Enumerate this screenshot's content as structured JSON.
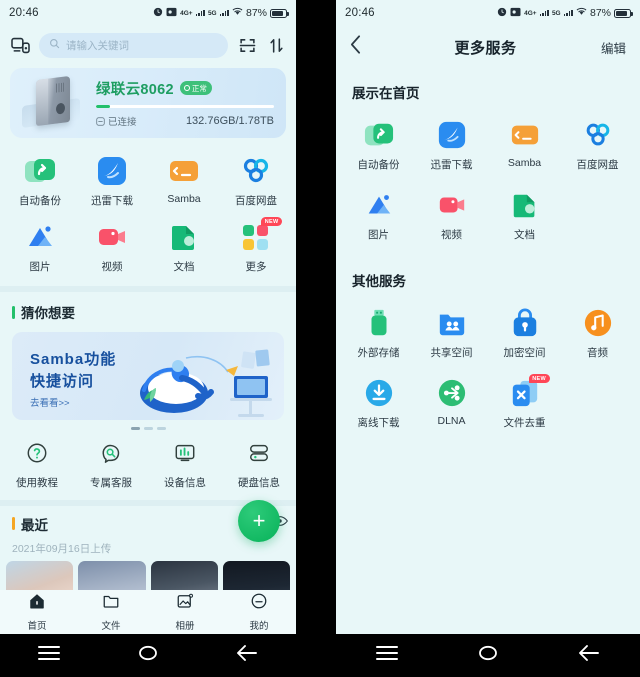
{
  "status_bar": {
    "time": "20:46",
    "battery_percent": "87%",
    "net_1": "4G+",
    "net_2": "5G",
    "icons": [
      "alarm-icon",
      "screen-record-icon",
      "signal-icon",
      "signal-icon",
      "wifi-icon",
      "battery-icon"
    ]
  },
  "left": {
    "toolbar": {
      "cast_icon": "cast-device-icon",
      "search_placeholder": "请输入关键词",
      "search_icon": "search-icon",
      "scan_icon": "scan-code-icon",
      "transfer_icon": "transfer-icon"
    },
    "device": {
      "name": "绿联云8062",
      "status_badge": "正常",
      "connection": "已连接",
      "capacity": "132.76GB/1.78TB",
      "usage_percent": 8,
      "image": "nas-device-image"
    },
    "apps": [
      {
        "label": "自动备份",
        "icon": "auto-backup-icon"
      },
      {
        "label": "迅雷下载",
        "icon": "xunlei-download-icon"
      },
      {
        "label": "Samba",
        "icon": "samba-icon"
      },
      {
        "label": "百度网盘",
        "icon": "baidu-netdisk-icon"
      },
      {
        "label": "图片",
        "icon": "photos-icon"
      },
      {
        "label": "视频",
        "icon": "video-icon"
      },
      {
        "label": "文档",
        "icon": "document-icon"
      },
      {
        "label": "更多",
        "icon": "more-apps-icon",
        "badge": "NEW"
      }
    ],
    "guess": {
      "title": "猜你想要",
      "accent": "#23c06b",
      "banner": {
        "line1": "Samba功能",
        "line2": "快捷访问",
        "cta": "去看看>>"
      },
      "dots": 4,
      "active_dot": 0
    },
    "tools": [
      {
        "label": "使用教程",
        "icon": "question-circle-icon"
      },
      {
        "label": "专属客服",
        "icon": "customer-service-icon"
      },
      {
        "label": "设备信息",
        "icon": "device-info-icon"
      },
      {
        "label": "硬盘信息",
        "icon": "disk-info-icon"
      }
    ],
    "recent": {
      "title": "最近",
      "accent": "#f5a623",
      "date": "2021年09月16日上传",
      "fab_label": "+",
      "eye_icon": "eye-icon"
    },
    "tabbar": [
      {
        "label": "首页",
        "icon": "home-icon",
        "active": true
      },
      {
        "label": "文件",
        "icon": "folder-icon",
        "active": false
      },
      {
        "label": "相册",
        "icon": "album-icon",
        "active": false
      },
      {
        "label": "我的",
        "icon": "profile-icon",
        "active": false
      }
    ]
  },
  "right": {
    "appbar": {
      "back_icon": "back-chevron-icon",
      "title": "更多服务",
      "edit": "编辑"
    },
    "section_home": {
      "title": "展示在首页",
      "apps": [
        {
          "label": "自动备份",
          "icon": "auto-backup-icon"
        },
        {
          "label": "迅雷下载",
          "icon": "xunlei-download-icon"
        },
        {
          "label": "Samba",
          "icon": "samba-icon"
        },
        {
          "label": "百度网盘",
          "icon": "baidu-netdisk-icon"
        },
        {
          "label": "图片",
          "icon": "photos-icon"
        },
        {
          "label": "视频",
          "icon": "video-icon"
        },
        {
          "label": "文档",
          "icon": "document-icon"
        }
      ]
    },
    "section_other": {
      "title": "其他服务",
      "apps": [
        {
          "label": "外部存储",
          "icon": "usb-storage-icon"
        },
        {
          "label": "共享空间",
          "icon": "shared-space-icon"
        },
        {
          "label": "加密空间",
          "icon": "encrypted-space-icon"
        },
        {
          "label": "音频",
          "icon": "audio-icon"
        },
        {
          "label": "离线下载",
          "icon": "offline-download-icon"
        },
        {
          "label": "DLNA",
          "icon": "dlna-icon"
        },
        {
          "label": "文件去重",
          "icon": "file-dedupe-icon",
          "badge": "NEW"
        }
      ]
    }
  },
  "navbar": {
    "menu_icon": "menu-icon",
    "home_icon": "home-pill-icon",
    "back_icon": "back-arrow-icon"
  }
}
